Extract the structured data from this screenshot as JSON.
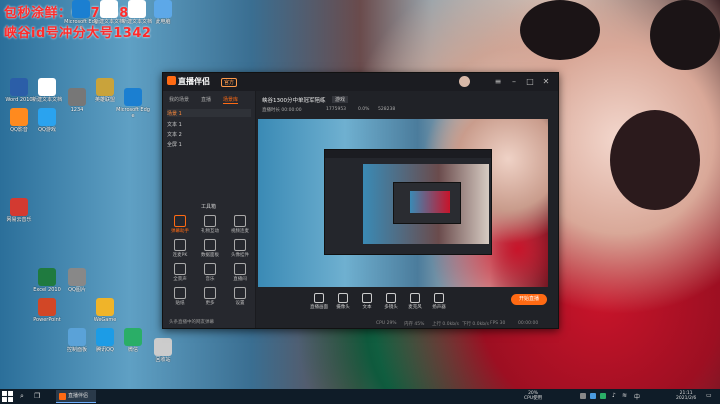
{
  "overlay": {
    "line1": "包秒涂鲜：607458",
    "line2": "峡谷id号冲分大号1342"
  },
  "desktop_icons": [
    {
      "label": "Microsoft Edge",
      "color": "#1b7fd1"
    },
    {
      "label": "新建文本文档",
      "color": "#ffffff"
    },
    {
      "label": "新建文本文档",
      "color": "#ffffff"
    },
    {
      "label": "此电脑",
      "color": "#5da8e8"
    },
    {
      "label": "Word 2010",
      "color": "#2b5ea8"
    },
    {
      "label": "新建文本文档",
      "color": "#ffffff"
    },
    {
      "label": "1234",
      "color": "#777777"
    },
    {
      "label": "英雄联盟",
      "color": "#c9a33b"
    },
    {
      "label": "Microsoft Edge",
      "color": "#1b7fd1"
    },
    {
      "label": "QQ影音",
      "color": "#ff8a1e"
    },
    {
      "label": "QQ游戏",
      "color": "#2aa3ef"
    },
    {
      "label": "网易云音乐",
      "color": "#d33a31"
    },
    {
      "label": "Excel 2010",
      "color": "#1f7a3f"
    },
    {
      "label": "QQ图片",
      "color": "#888888"
    },
    {
      "label": "PowerPoint",
      "color": "#d24726"
    },
    {
      "label": "WeGame",
      "color": "#f0b429"
    },
    {
      "label": "腾讯QQ",
      "color": "#1c9ce6"
    },
    {
      "label": "微信",
      "color": "#2aae67"
    },
    {
      "label": "控制面板",
      "color": "#5aa2d8"
    },
    {
      "label": "回收站",
      "color": "#cccccc"
    }
  ],
  "app": {
    "name": "直播伴侣",
    "badge": "官方",
    "side_tabs": [
      "我的场景",
      "直播",
      "场景库"
    ],
    "scene_items": [
      "场景 1",
      "文本 1",
      "文本 2",
      "全屏 1"
    ],
    "tools_header": "工具箱",
    "tools": [
      "弹幕助手",
      "礼物互动",
      "视频连麦",
      "连麦PK",
      "数据面板",
      "头像挂件",
      "全景声",
      "音乐",
      "直播间",
      "贴纸",
      "更多",
      "设置"
    ],
    "side_footer": "头条直播中的网友弹幕",
    "title": "峡谷1300分中单冠军陪练",
    "tag": "游戏",
    "stats": [
      "直播时长 00:00:00",
      "1775953",
      "0.0%",
      "528238"
    ],
    "controls": [
      "直播画面",
      "摄像头",
      "文本",
      "多镜头",
      "麦克风",
      "扬声器"
    ],
    "live_button": "开始直播",
    "bottom_stats": [
      "CPU 29%",
      "内存 45%",
      "上行 0.0kb/s",
      "下行 0.0kb/s",
      "FPS 30",
      "00:00:00"
    ]
  },
  "taskbar": {
    "app_label": "直播伴侣",
    "cpu": "20%",
    "cpu_label": "CPU使用",
    "time": "21:11",
    "date": "2021/2/6",
    "lang": "中"
  }
}
